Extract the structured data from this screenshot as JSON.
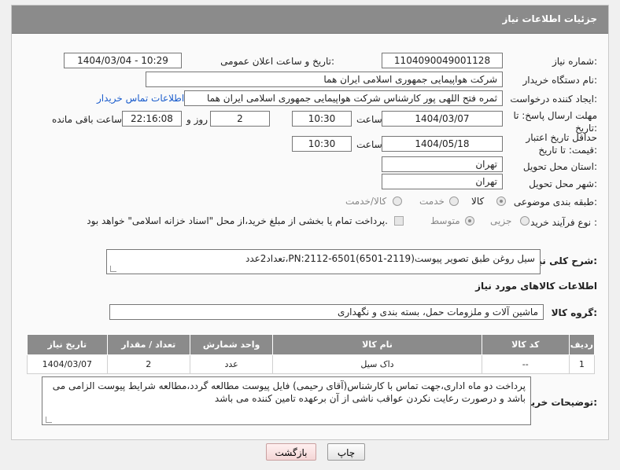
{
  "header": {
    "title": "جزئیات اطلاعات نیاز"
  },
  "fields": {
    "need_number_label": "شماره نیاز:",
    "need_number": "1104090049001128",
    "announce_label": "تاریخ و ساعت اعلان عمومی:",
    "announce_value": "1404/03/04 - 10:29",
    "buyer_org_label": "نام دستگاه خریدار:",
    "buyer_org": "شرکت هواپیمایی جمهوری اسلامی ایران هما",
    "requester_label": "ایجاد کننده درخواست:",
    "requester": "ثمره فتح اللهی پور کارشناس شرکت هواپیمایی جمهوری اسلامی ایران هما",
    "buyer_contact_link": "اطلاعات تماس خریدار",
    "reply_deadline_label": "مهلت ارسال پاسخ: تا تاریخ:",
    "reply_date": "1404/03/07",
    "time_label": "ساعت",
    "reply_time": "10:30",
    "days_value": "2",
    "days_label": "روز و",
    "remaining_time": "22:16:08",
    "remaining_label": "ساعت باقی مانده",
    "price_validity_label": "حداقل تاریخ اعتبار قیمت: تا تاریخ:",
    "price_date": "1404/05/18",
    "price_time": "10:30",
    "province_label": "استان محل تحویل:",
    "province": "تهران",
    "city_label": "شهر محل تحویل:",
    "city": "تهران",
    "category_label": "طبقه بندی موضوعی:",
    "category_options": [
      "کالا",
      "خدمت",
      "کالا/خدمت"
    ],
    "process_label": "نوع فرآیند خرید :",
    "process_options": [
      "جزیی",
      "متوسط"
    ],
    "payment_note": "پرداخت تمام یا بخشی از مبلغ خرید،از محل \"اسناد خزانه اسلامی\" خواهد بود."
  },
  "summary": {
    "label": "شرح کلی نیاز:",
    "text": "سیل روغن طبق تصویر پیوست(2119-6501)PN:2112-6501،تعداد2عدد"
  },
  "goods_info": {
    "title": "اطلاعات کالاهای مورد نیاز",
    "group_label": "گروه کالا:",
    "group_value": "ماشین آلات و ملزومات حمل، بسته بندی و نگهداری"
  },
  "table": {
    "headers": [
      "ردیف",
      "کد کالا",
      "نام کالا",
      "واحد شمارش",
      "تعداد / مقدار",
      "تاریخ نیاز"
    ],
    "rows": [
      [
        "1",
        "--",
        "داک سیل",
        "عدد",
        "2",
        "1404/03/07"
      ]
    ]
  },
  "buyer_notes": {
    "label": "توضیحات خریدار:",
    "text": "پرداخت دو ماه اداری،جهت تماس با کارشناس(آقای رحیمی) فایل پیوست مطالعه گردد،مطالعه شرایط پیوست الزامی می باشد و درصورت رعایت نکردن عواقب ناشی از آن برعهده تامین کننده می باشد"
  },
  "buttons": {
    "print": "چاپ",
    "back": "بازگشت"
  }
}
